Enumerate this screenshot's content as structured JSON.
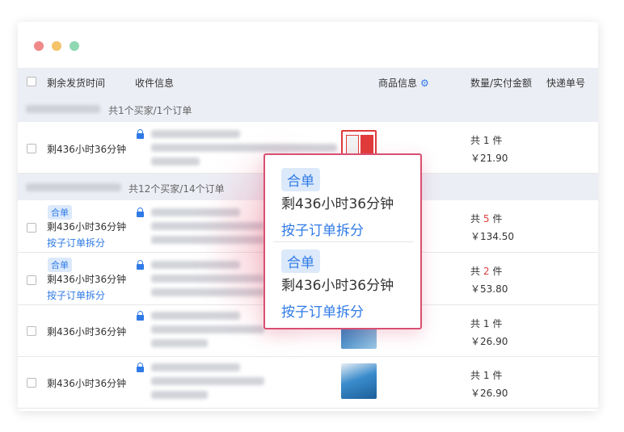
{
  "header": {
    "col_time": "剩余发货时间",
    "col_receiver": "收件信息",
    "col_goods": "商品信息",
    "col_qty": "数量/实付金额",
    "col_express": "快递单号"
  },
  "groups": [
    {
      "count": "共1个买家/1个订单"
    },
    {
      "count": "共12个买家/14个订单"
    }
  ],
  "rows": [
    {
      "tag": "",
      "time": "剩436小时36分钟",
      "split": "",
      "qty_prefix": "共",
      "qty": "1",
      "qty_suffix": "件",
      "amount": "￥21.90"
    },
    {
      "tag": "合单",
      "time": "剩436小时36分钟",
      "split": "按子订单拆分",
      "qty_prefix": "共",
      "qty": "5",
      "qty_suffix": "件",
      "amount": "￥134.50"
    },
    {
      "tag": "合单",
      "time": "剩436小时36分钟",
      "split": "按子订单拆分",
      "qty_prefix": "共",
      "qty": "2",
      "qty_suffix": "件",
      "amount": "￥53.80"
    },
    {
      "tag": "",
      "time": "剩436小时36分钟",
      "split": "",
      "qty_prefix": "共",
      "qty": "1",
      "qty_suffix": "件",
      "amount": "￥26.90"
    },
    {
      "tag": "",
      "time": "剩436小时36分钟",
      "split": "",
      "qty_prefix": "共",
      "qty": "1",
      "qty_suffix": "件",
      "amount": "￥26.90"
    }
  ],
  "popup": {
    "items": [
      {
        "tag": "合单",
        "time": "剩436小时36分钟",
        "split": "按子订单拆分"
      },
      {
        "tag": "合单",
        "time": "剩436小时36分钟",
        "split": "按子订单拆分"
      }
    ]
  },
  "colors": {
    "accent": "#2f7ae6",
    "highlight": "#d94f72",
    "qty_red": "#e04040"
  },
  "icons": {
    "header_settings": "gear-icon",
    "receiver_lock": "lock-icon"
  }
}
